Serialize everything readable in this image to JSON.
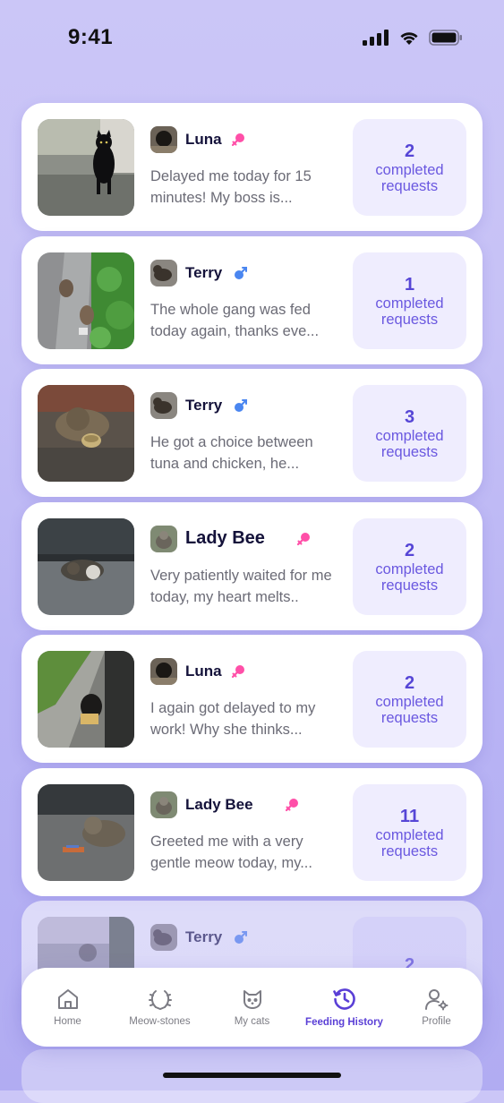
{
  "status_bar": {
    "time": "9:41"
  },
  "feed": [
    {
      "name": "Luna",
      "gender": "female",
      "message": "Delayed me today for 15 minutes! My boss is...",
      "count": "2",
      "label": "completed requests"
    },
    {
      "name": "Terry",
      "gender": "male",
      "message": "The whole gang was fed today again, thanks eve...",
      "count": "1",
      "label": "completed requests"
    },
    {
      "name": "Terry",
      "gender": "male",
      "message": "He got a choice between tuna and chicken, he...",
      "count": "3",
      "label": "completed requests"
    },
    {
      "name": "Lady Bee",
      "gender": "female",
      "message": "Very patiently waited for me today, my heart melts..",
      "count": "2",
      "label": "completed requests"
    },
    {
      "name": "Luna",
      "gender": "female",
      "message": "I again got delayed to my work! Why she thinks...",
      "count": "2",
      "label": "completed requests"
    },
    {
      "name": "Lady Bee",
      "gender": "female",
      "message": "Greeted me with a very gentle meow today, my...",
      "count": "11",
      "label": "completed requests"
    },
    {
      "name": "Terry",
      "gender": "male",
      "message": "",
      "count": "2",
      "label": ""
    }
  ],
  "tab_bar": {
    "items": [
      {
        "label": "Home",
        "icon": "home-icon"
      },
      {
        "label": "Meow-stones",
        "icon": "laurel-icon"
      },
      {
        "label": "My cats",
        "icon": "cat-icon"
      },
      {
        "label": "Feeding History",
        "icon": "history-icon",
        "active": true
      },
      {
        "label": "Profile",
        "icon": "profile-settings-icon"
      }
    ]
  },
  "colors": {
    "accent": "#5a3fd6",
    "female": "#ff4fa8",
    "male": "#4a86f0",
    "request_bg": "#efedfe"
  }
}
